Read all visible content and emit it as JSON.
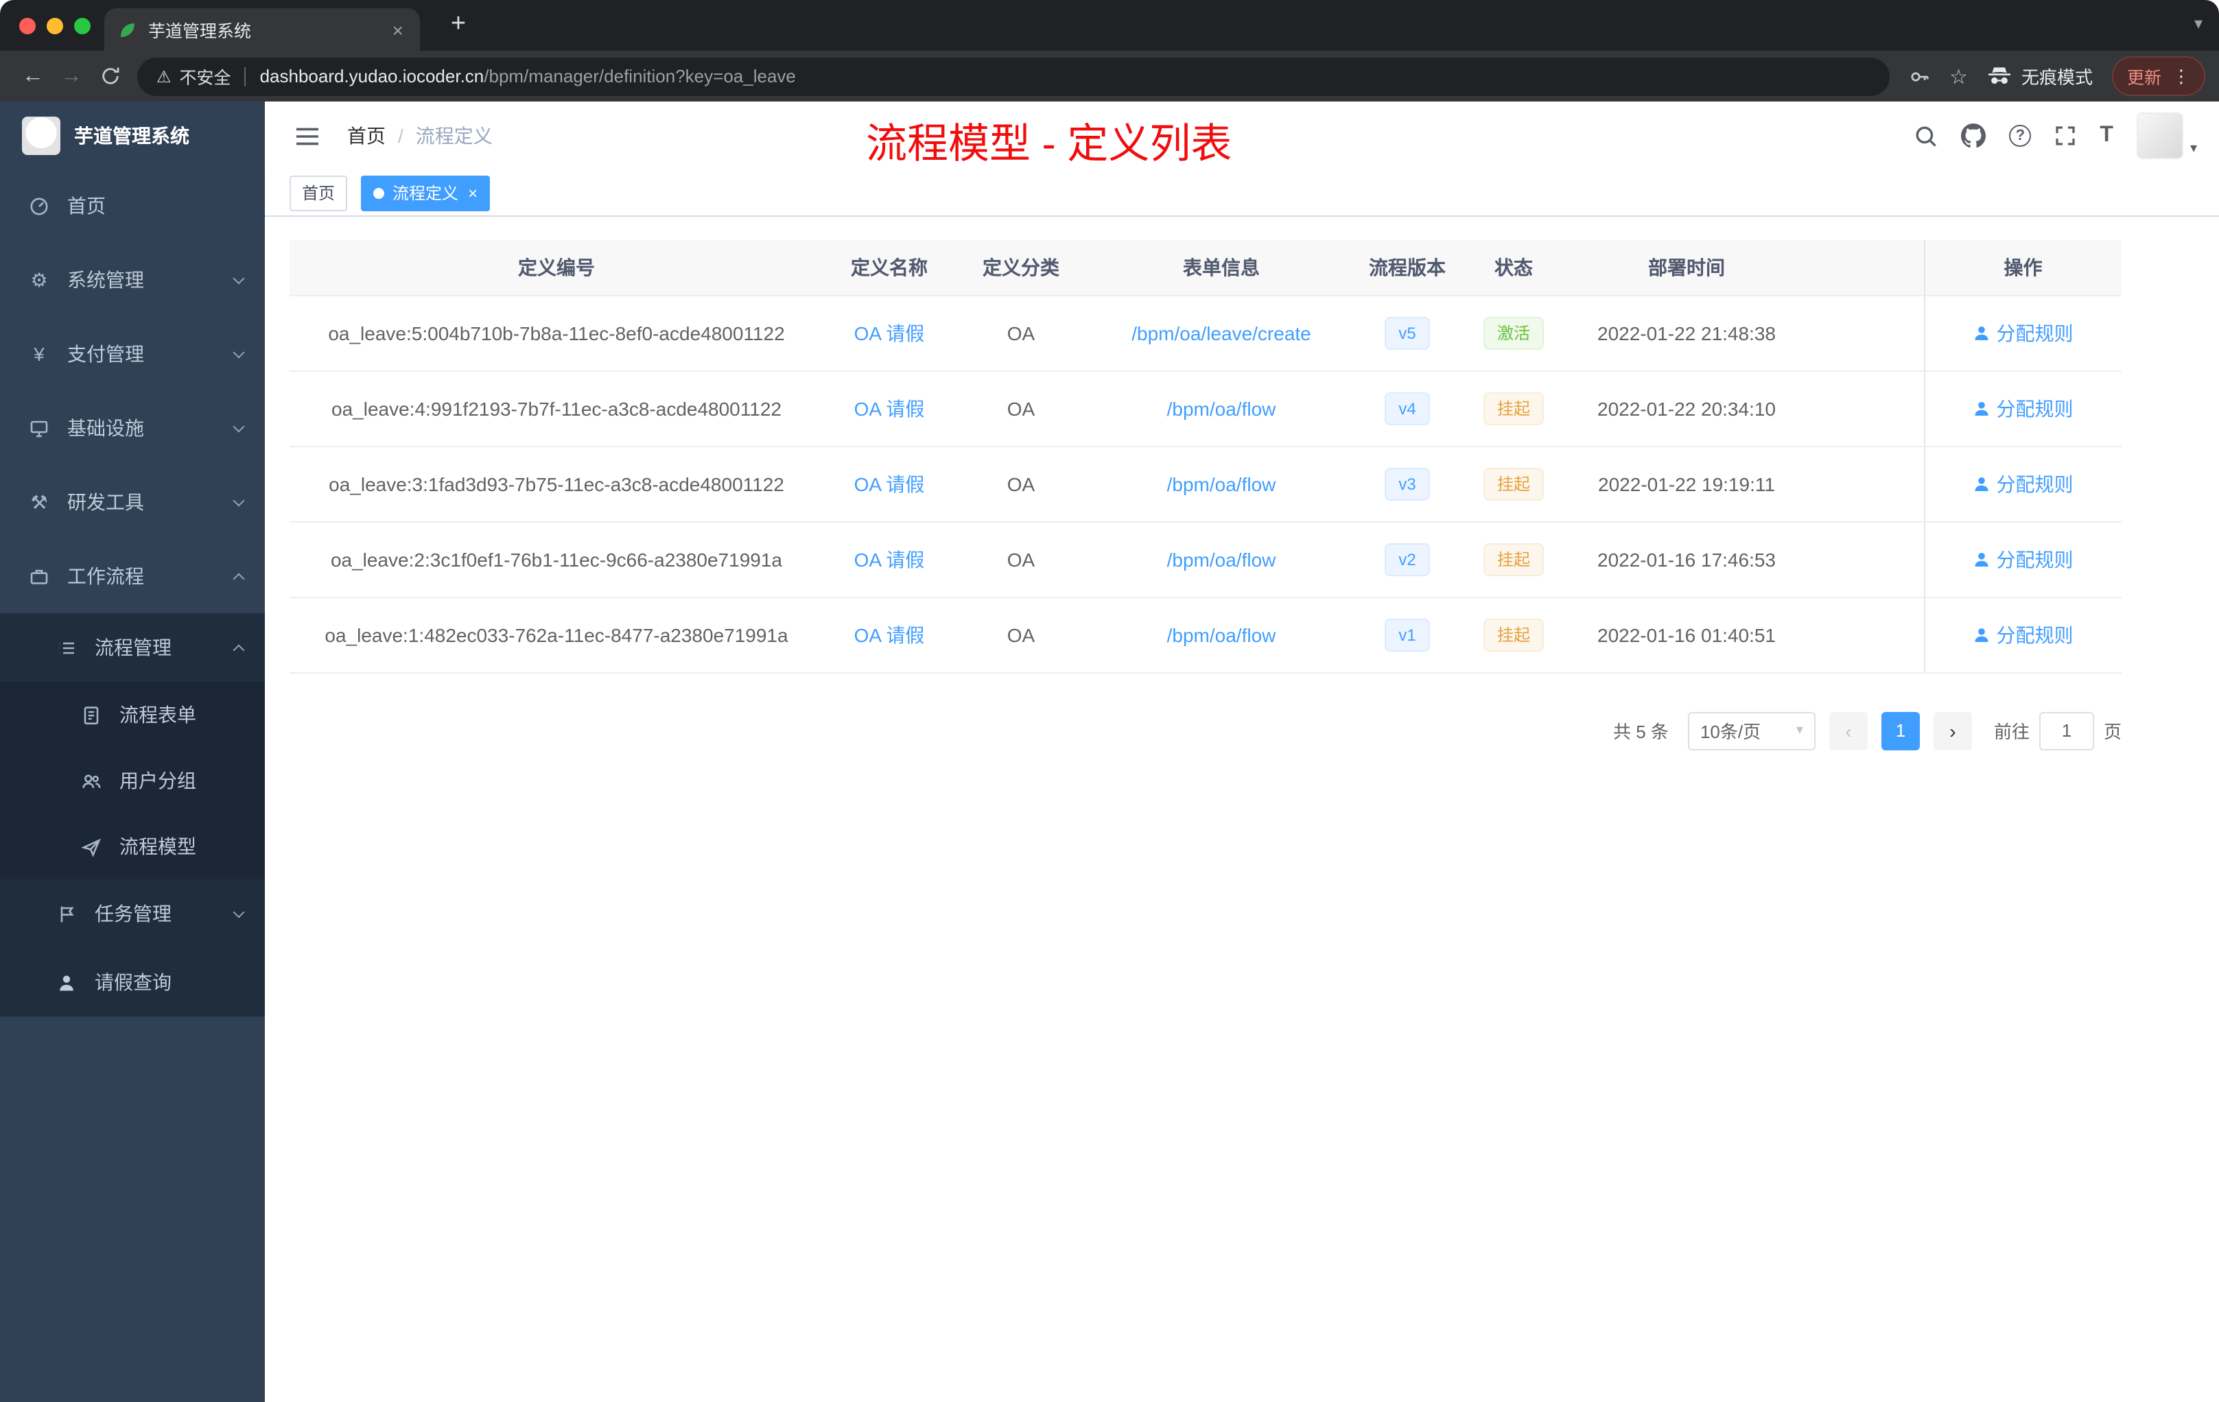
{
  "browser": {
    "tab_title": "芋道管理系统",
    "security_label": "不安全",
    "url_domain": "dashboard.yudao.iocoder.cn",
    "url_path": "/bpm/manager/definition?key=oa_leave",
    "incognito_label": "无痕模式",
    "update_label": "更新"
  },
  "glyphs": {
    "back": "←",
    "forward": "→",
    "plus": "+",
    "close": "×",
    "caret_down": "▾",
    "dots": "⋮",
    "star": "☆",
    "warning": "⚠",
    "question": "?",
    "font_icon": "T",
    "payment": "¥",
    "gear": "⚙",
    "tools": "⚒",
    "prev": "‹",
    "next": "›"
  },
  "sidebar": {
    "logo_title": "芋道管理系统",
    "items": [
      {
        "label": "首页"
      },
      {
        "label": "系统管理"
      },
      {
        "label": "支付管理"
      },
      {
        "label": "基础设施"
      },
      {
        "label": "研发工具"
      },
      {
        "label": "工作流程"
      }
    ],
    "process_mgmt": {
      "label": "流程管理",
      "children": [
        {
          "label": "流程表单"
        },
        {
          "label": "用户分组"
        },
        {
          "label": "流程模型"
        }
      ]
    },
    "task_mgmt": {
      "label": "任务管理"
    },
    "leave_query": {
      "label": "请假查询"
    }
  },
  "header": {
    "breadcrumb": {
      "home": "首页",
      "separator": "/",
      "current": "流程定义"
    },
    "annotation": "流程模型 - 定义列表"
  },
  "tags": {
    "home": "首页",
    "current": "流程定义"
  },
  "table": {
    "headers": [
      "定义编号",
      "定义名称",
      "定义分类",
      "表单信息",
      "流程版本",
      "状态",
      "部署时间",
      "操作"
    ],
    "rows": [
      {
        "id": "oa_leave:5:004b710b-7b8a-11ec-8ef0-acde48001122",
        "name": "OA 请假",
        "category": "OA",
        "form": "/bpm/oa/leave/create",
        "version": "v5",
        "status": "激活",
        "status_type": "success",
        "deploy_time": "2022-01-22 21:48:38",
        "action": "分配规则"
      },
      {
        "id": "oa_leave:4:991f2193-7b7f-11ec-a3c8-acde48001122",
        "name": "OA 请假",
        "category": "OA",
        "form": "/bpm/oa/flow",
        "version": "v4",
        "status": "挂起",
        "status_type": "warning",
        "deploy_time": "2022-01-22 20:34:10",
        "action": "分配规则"
      },
      {
        "id": "oa_leave:3:1fad3d93-7b75-11ec-a3c8-acde48001122",
        "name": "OA 请假",
        "category": "OA",
        "form": "/bpm/oa/flow",
        "version": "v3",
        "status": "挂起",
        "status_type": "warning",
        "deploy_time": "2022-01-22 19:19:11",
        "action": "分配规则"
      },
      {
        "id": "oa_leave:2:3c1f0ef1-76b1-11ec-9c66-a2380e71991a",
        "name": "OA 请假",
        "category": "OA",
        "form": "/bpm/oa/flow",
        "version": "v2",
        "status": "挂起",
        "status_type": "warning",
        "deploy_time": "2022-01-16 17:46:53",
        "action": "分配规则"
      },
      {
        "id": "oa_leave:1:482ec033-762a-11ec-8477-a2380e71991a",
        "name": "OA 请假",
        "category": "OA",
        "form": "/bpm/oa/flow",
        "version": "v1",
        "status": "挂起",
        "status_type": "warning",
        "deploy_time": "2022-01-16 01:40:51",
        "action": "分配规则"
      }
    ]
  },
  "pagination": {
    "total": "共 5 条",
    "page_size": "10条/页",
    "current_page": "1",
    "goto_label": "前往",
    "goto_page": "1",
    "goto_unit": "页"
  },
  "colors": {
    "accent": "#409eff",
    "success": "#67c23a",
    "warning": "#e6a23c",
    "annotation_red": "#f20d0d",
    "sidebar_bg": "#304156",
    "sidebar_sub_bg": "#1f2d3d"
  }
}
